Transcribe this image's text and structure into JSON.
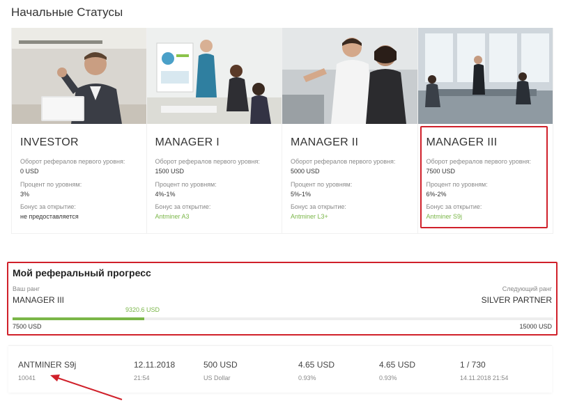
{
  "page_title": "Начальные Статусы",
  "cards": [
    {
      "name": "INVESTOR",
      "turnover_label": "Оборот рефералов первого уровня:",
      "turnover": "0 USD",
      "percent_label": "Процент по уровням:",
      "percent": "3%",
      "bonus_label": "Бонус за открытие:",
      "bonus": "не предоставляется"
    },
    {
      "name": "MANAGER I",
      "turnover_label": "Оборот рефералов первого уровня:",
      "turnover": "1500 USD",
      "percent_label": "Процент по уровням:",
      "percent": "4%-1%",
      "bonus_label": "Бонус за открытие:",
      "bonus": "Antminer A3"
    },
    {
      "name": "MANAGER II",
      "turnover_label": "Оборот рефералов первого уровня:",
      "turnover": "5000 USD",
      "percent_label": "Процент по уровням:",
      "percent": "5%-1%",
      "bonus_label": "Бонус за открытие:",
      "bonus": "Antminer L3+"
    },
    {
      "name": "MANAGER III",
      "turnover_label": "Оборот рефералов первого уровня:",
      "turnover": "7500 USD",
      "percent_label": "Процент по уровням:",
      "percent": "6%-2%",
      "bonus_label": "Бонус за открытие:",
      "bonus": "Antminer S9j"
    }
  ],
  "progress": {
    "title": "Мой реферальный прогресс",
    "your_rank_label": "Ваш ранг",
    "your_rank": "MANAGER III",
    "next_rank_label": "Следующий ранг",
    "next_rank": "SILVER PARTNER",
    "current_amount": "9320.6 USD",
    "min": "7500 USD",
    "max": "15000 USD",
    "fill_fraction": 0.243
  },
  "deposit": {
    "product": "ANTMINER S9j",
    "id": "10041",
    "date": "12.11.2018",
    "time": "21:54",
    "amount": "500 USD",
    "currency": "US Dollar",
    "profit1": "4.65 USD",
    "profit1_pct": "0.93%",
    "profit2": "4.65 USD",
    "profit2_pct": "0.93%",
    "progress": "1 / 730",
    "next_date": "14.11.2018 21:54"
  },
  "colors": {
    "accent_green": "#7ab648",
    "highlight_red": "#d0202a"
  }
}
